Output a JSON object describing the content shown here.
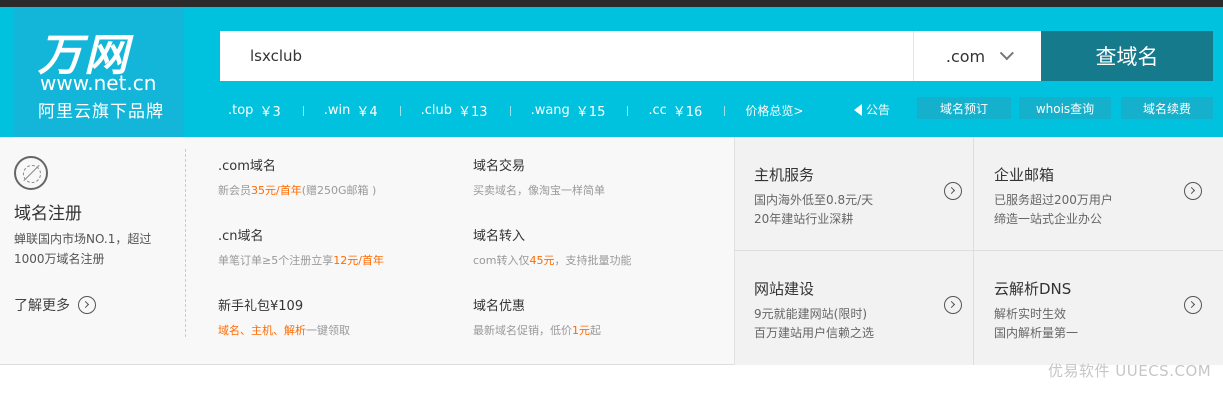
{
  "logo": {
    "name": "万网",
    "url": "www.net.cn",
    "tagline": "阿里云旗下品牌"
  },
  "search": {
    "value": "lsxclub",
    "extension": ".com",
    "button": "查域名"
  },
  "prices": [
    {
      "ext": ".top",
      "price": "￥3"
    },
    {
      "ext": ".win",
      "price": "￥4"
    },
    {
      "ext": ".club",
      "price": "￥13"
    },
    {
      "ext": ".wang",
      "price": "￥15"
    },
    {
      "ext": ".cc",
      "price": "￥16"
    }
  ],
  "price_total": "价格总览>",
  "notice": "公告",
  "header_buttons": [
    "域名预订",
    "whois查询",
    "域名续费"
  ],
  "domain_reg": {
    "title": "域名注册",
    "desc": "蝉联国内市场NO.1，超过1000万域名注册",
    "more": "了解更多"
  },
  "features": [
    {
      "title": ".com域名",
      "pre": "新会员",
      "hl": "35元/首年",
      "post": "(赠250G邮箱 )"
    },
    {
      "title": "域名交易",
      "pre": "买卖域名，像淘宝一样简单",
      "hl": "",
      "post": ""
    },
    {
      "title": ".cn域名",
      "pre": "单笔订单≥5个注册立享",
      "hl": "12元/首年",
      "post": ""
    },
    {
      "title": "域名转入",
      "pre": "com转入仅",
      "hl": "45元",
      "post": "，支持批量功能"
    },
    {
      "title": "新手礼包¥109",
      "pre": "",
      "hl": "域名、主机、解析",
      "post": "一键领取"
    },
    {
      "title": "域名优惠",
      "pre": "最新域名促销，低价",
      "hl": "1元",
      "post": "起"
    }
  ],
  "services": [
    {
      "title": "主机服务",
      "line1": "国内海外低至0.8元/天",
      "line2": "20年建站行业深耕"
    },
    {
      "title": "企业邮箱",
      "line1": "已服务超过200万用户",
      "line2": "缔造一站式企业办公"
    },
    {
      "title": "网站建设",
      "line1": "9元就能建网站(限时)",
      "line2": "百万建站用户信赖之选"
    },
    {
      "title": "云解析DNS",
      "line1": "解析实时生效",
      "line2": "国内解析量第一"
    }
  ],
  "watermark": "优易软件 UUECS.COM",
  "colors": {
    "header": "#00c1de",
    "search_button": "#157a8b",
    "highlight": "#ff6a00"
  }
}
